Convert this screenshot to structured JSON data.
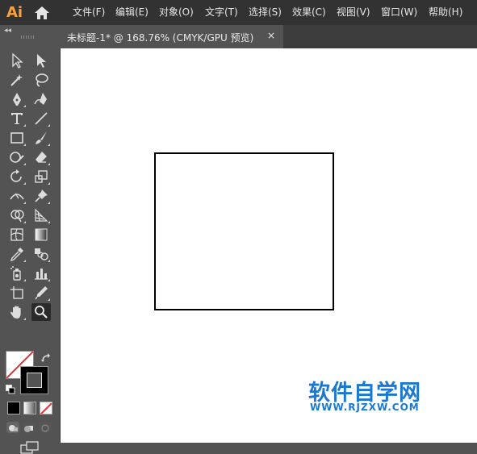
{
  "app": {
    "logo": "Ai"
  },
  "menu": [
    "文件(F)",
    "编辑(E)",
    "对象(O)",
    "文字(T)",
    "选择(S)",
    "效果(C)",
    "视图(V)",
    "窗口(W)",
    "帮助(H)"
  ],
  "tab": {
    "title": "未标题-1* @ 168.76% (CMYK/GPU 预览)",
    "close": "×"
  },
  "toolbar": {
    "collapse": "◂◂"
  },
  "watermark": {
    "title": "软件自学网",
    "url": "WWW.RJZXW.COM"
  },
  "colors": {
    "menubar": "#323232",
    "panel": "#535353",
    "canvas": "#ffffff",
    "watermark": "#1b78d0",
    "logo": "#f7a140"
  },
  "tools": [
    "selection-tool",
    "direct-selection-tool",
    "magic-wand-tool",
    "lasso-tool",
    "pen-tool",
    "curvature-tool",
    "type-tool",
    "line-segment-tool",
    "rectangle-tool",
    "paintbrush-tool",
    "shaper-tool",
    "eraser-tool",
    "rotate-tool",
    "scale-tool",
    "width-tool",
    "puppet-warp-tool",
    "shape-builder-tool",
    "perspective-grid-tool",
    "mesh-tool",
    "gradient-tool",
    "eyedropper-tool",
    "blend-tool",
    "symbol-sprayer-tool",
    "column-graph-tool",
    "artboard-tool",
    "slice-tool",
    "hand-tool",
    "zoom-tool"
  ]
}
